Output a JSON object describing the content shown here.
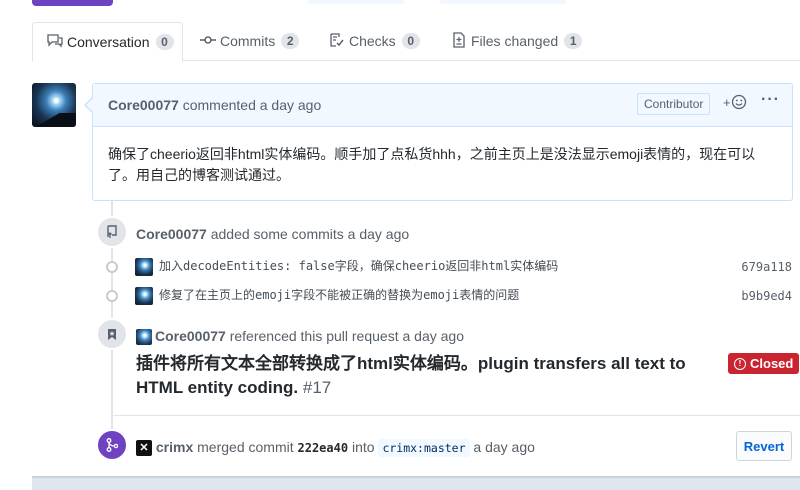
{
  "tabs": [
    {
      "label": "Conversation",
      "count": "0",
      "icon": "comment-discussion-icon"
    },
    {
      "label": "Commits",
      "count": "2",
      "icon": "git-commit-icon"
    },
    {
      "label": "Checks",
      "count": "0",
      "icon": "checklist-icon"
    },
    {
      "label": "Files changed",
      "count": "1",
      "icon": "file-diff-icon"
    }
  ],
  "comment": {
    "author": "Core00077",
    "action": "commented a day ago",
    "badge": "Contributor",
    "reaction": "+☺",
    "more": "···",
    "body": "确保了cheerio返回非html实体编码。顺手加了点私货hhh，之前主页上是没法显示emoji表情的，现在可以了。用自己的博客测试通过。"
  },
  "commits_event": {
    "author": "Core00077",
    "action": "added some commits a day ago",
    "commits": [
      {
        "message": "加入decodeEntities: false字段，确保cheerio返回非html实体编码",
        "sha": "679a118"
      },
      {
        "message": "修复了在主页上的emoji字段不能被正确的替换为emoji表情的问题",
        "sha": "b9b9ed4"
      }
    ]
  },
  "reference_event": {
    "author": "Core00077",
    "action": "referenced this pull request a day ago",
    "title": "插件将所有文本全部转换成了html实体编码。plugin transfers all text to HTML entity coding.",
    "number": "#17",
    "status": "Closed"
  },
  "merge_event": {
    "author": "crimx",
    "action": "merged commit",
    "commit": "222ea40",
    "into": "into",
    "branch": "crimx:master",
    "time": "a day ago",
    "revert_label": "Revert"
  },
  "colors": {
    "accent_purple": "#6f42c1",
    "closed_red": "#cb2431",
    "link_blue": "#0366d6",
    "comment_header_bg": "#f1f8ff"
  }
}
